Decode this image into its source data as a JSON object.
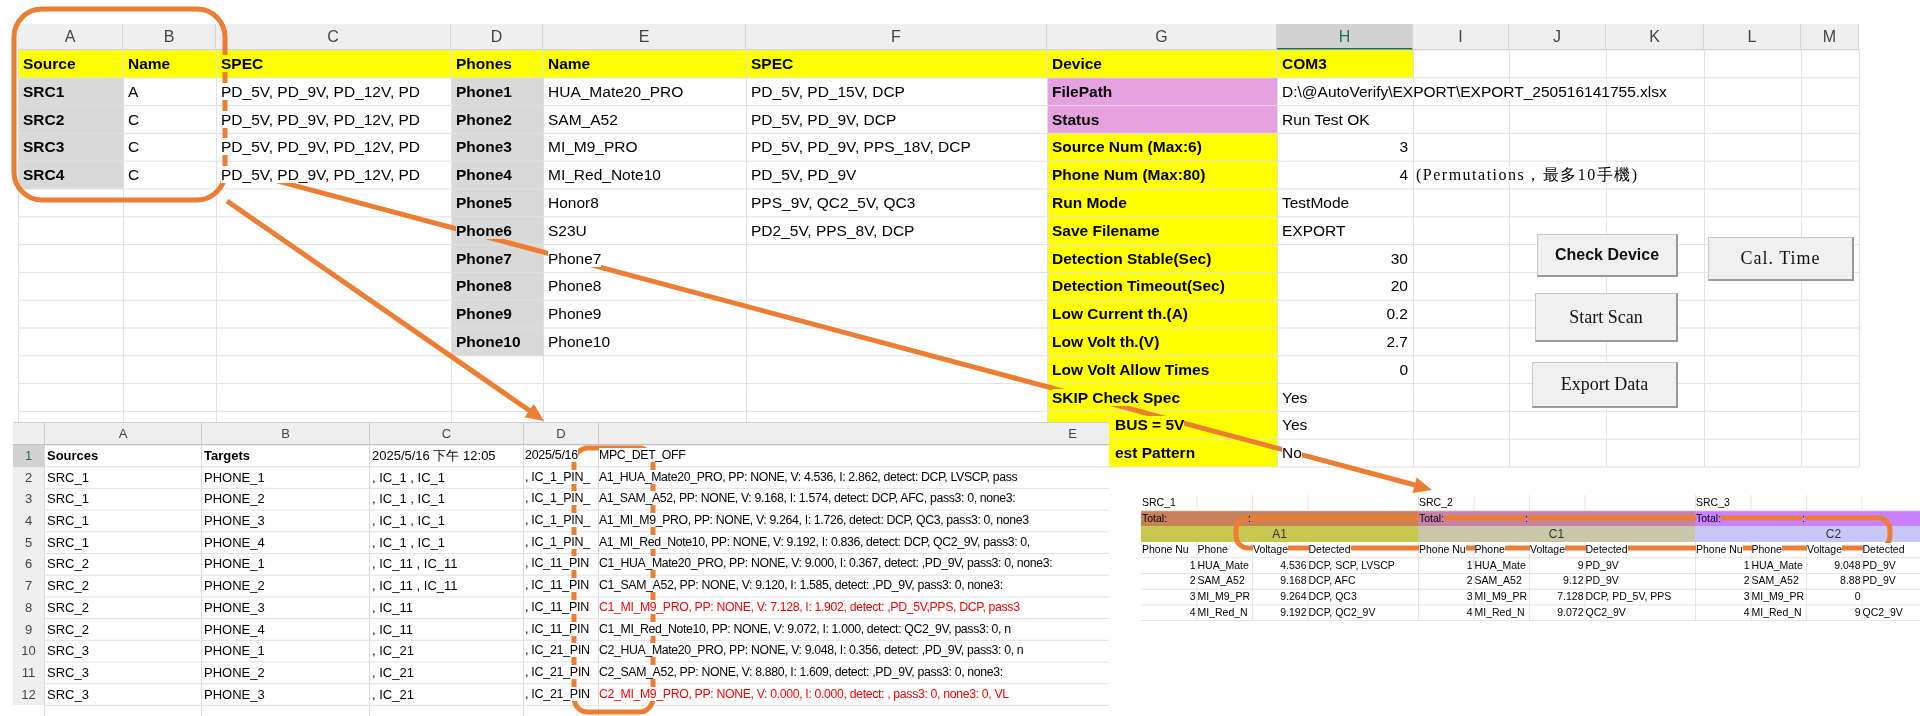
{
  "top_sheet": {
    "columns": [
      {
        "label": "A",
        "selected": false
      },
      {
        "label": "B",
        "selected": false
      },
      {
        "label": "C",
        "selected": false
      },
      {
        "label": "D",
        "selected": false
      },
      {
        "label": "E",
        "selected": false
      },
      {
        "label": "F",
        "selected": false
      },
      {
        "label": "G",
        "selected": false
      },
      {
        "label": "H",
        "selected": true
      },
      {
        "label": "I",
        "selected": false
      },
      {
        "label": "J",
        "selected": false
      },
      {
        "label": "K",
        "selected": false
      },
      {
        "label": "L",
        "selected": false
      },
      {
        "label": "M",
        "selected": false
      }
    ],
    "sources": {
      "header": [
        "Source",
        "Name",
        "SPEC"
      ],
      "rows": [
        {
          "source": "SRC1",
          "name": "A",
          "spec": "PD_5V, PD_9V, PD_12V, PD"
        },
        {
          "source": "SRC2",
          "name": "C",
          "spec": "PD_5V, PD_9V, PD_12V, PD"
        },
        {
          "source": "SRC3",
          "name": "C",
          "spec": "PD_5V, PD_9V, PD_12V, PD"
        },
        {
          "source": "SRC4",
          "name": "C",
          "spec": "PD_5V, PD_9V, PD_12V, PD"
        }
      ]
    },
    "phones": {
      "header": [
        "Phones",
        "Name",
        "SPEC"
      ],
      "rows": [
        {
          "phone": "Phone1",
          "name": "HUA_Mate20_PRO",
          "spec": "PD_5V, PD_15V, DCP"
        },
        {
          "phone": "Phone2",
          "name": "SAM_A52",
          "spec": "PD_5V, PD_9V, DCP"
        },
        {
          "phone": "Phone3",
          "name": "MI_M9_PRO",
          "spec": "PD_5V, PD_9V, PPS_18V, DCP"
        },
        {
          "phone": "Phone4",
          "name": "MI_Red_Note10",
          "spec": "PD_5V, PD_9V"
        },
        {
          "phone": "Phone5",
          "name": "Honor8",
          "spec": "PPS_9V, QC2_5V, QC3"
        },
        {
          "phone": "Phone6",
          "name": "S23U",
          "spec": "PD2_5V, PPS_8V, DCP"
        },
        {
          "phone": "Phone7",
          "name": "Phone7"
        },
        {
          "phone": "Phone8",
          "name": "Phone8"
        },
        {
          "phone": "Phone9",
          "name": "Phone9"
        },
        {
          "phone": "Phone10",
          "name": "Phone10"
        }
      ]
    },
    "settings": {
      "header": {
        "label": "Device",
        "value": "COM3",
        "color": "#ffff00"
      },
      "rows": [
        {
          "label": "FilePath",
          "value": "D:\\@AutoVerify\\EXPORT\\EXPORT_250516141755.xlsx",
          "kind": "text",
          "color": "#e6a1e0"
        },
        {
          "label": "Status",
          "value": "Run Test OK",
          "kind": "text",
          "color": "#e6a1e0"
        },
        {
          "label": "Source Num (Max:6)",
          "value": "3",
          "kind": "number",
          "color": "#ffff00"
        },
        {
          "label": "Phone Num (Max:80)",
          "value": "4",
          "kind": "number",
          "color": "#ffff00",
          "note": "(Permutations，最多10手機)"
        },
        {
          "label": "Run Mode",
          "value": "TestMode",
          "kind": "text",
          "color": "#ffff00"
        },
        {
          "label": "Save Filename",
          "value": "EXPORT",
          "kind": "text",
          "color": "#ffff00"
        },
        {
          "label": "Detection Stable(Sec)",
          "value": "30",
          "kind": "number",
          "color": "#ffff00"
        },
        {
          "label": "Detection Timeout(Sec)",
          "value": "20",
          "kind": "number",
          "color": "#ffff00"
        },
        {
          "label": "Low Current th.(A)",
          "value": "0.2",
          "kind": "number",
          "color": "#ffff00"
        },
        {
          "label": "Low Volt th.(V)",
          "value": "2.7",
          "kind": "number",
          "color": "#ffff00"
        },
        {
          "label": "Low Volt Allow Times",
          "value": "0",
          "kind": "number",
          "color": "#ffff00"
        },
        {
          "label": "SKIP Check Spec",
          "value": "Yes",
          "kind": "text",
          "color": "#ffff00"
        },
        {
          "label": "BUS = 5V",
          "value": "Yes",
          "kind": "text",
          "color": "#ffff00"
        },
        {
          "label": "est Pattern",
          "value": "No",
          "kind": "text",
          "color": "#ffff00"
        }
      ]
    },
    "buttons": [
      {
        "label": "Check Device",
        "kind": "sans"
      },
      {
        "label": "Cal. Time",
        "kind": "mono"
      },
      {
        "label": "Start Scan",
        "kind": "serif"
      },
      {
        "label": "Export Data",
        "kind": "serif"
      }
    ]
  },
  "log_sheet": {
    "columns": [
      "A",
      "B",
      "C",
      "D",
      "E"
    ],
    "rows": [
      {
        "number": "1",
        "kind": "header",
        "error": false,
        "cells": [
          "Sources",
          "Targets",
          "2025/5/16 下午 12:05",
          "2025/5/16",
          "MPC_DET_OFF"
        ]
      },
      {
        "number": "2",
        "kind": "data",
        "error": false,
        "cells": [
          "SRC_1",
          "PHONE_1",
          ", IC_1 , IC_1",
          ", IC_1_PIN_",
          "A1_HUA_Mate20_PRO, PP: NONE, V: 4.536, I: 2.862, detect: DCP, LVSCP, pass"
        ]
      },
      {
        "number": "3",
        "kind": "data",
        "error": false,
        "cells": [
          "SRC_1",
          "PHONE_2",
          ", IC_1 , IC_1",
          ", IC_1_PIN_",
          "A1_SAM_A52, PP: NONE, V: 9.168, I: 1.574, detect: DCP, AFC, pass3: 0, none3:"
        ]
      },
      {
        "number": "4",
        "kind": "data",
        "error": false,
        "cells": [
          "SRC_1",
          "PHONE_3",
          ", IC_1 , IC_1",
          ", IC_1_PIN_",
          "A1_MI_M9_PRO, PP: NONE, V: 9.264, I: 1.726, detect: DCP, QC3, pass3: 0, none3"
        ]
      },
      {
        "number": "5",
        "kind": "data",
        "error": false,
        "cells": [
          "SRC_1",
          "PHONE_4",
          ", IC_1 , IC_1",
          ", IC_1_PIN_",
          "A1_MI_Red_Note10, PP: NONE, V: 9.192, I: 0.836, detect: DCP, QC2_9V, pass3: 0,"
        ]
      },
      {
        "number": "6",
        "kind": "data",
        "error": false,
        "cells": [
          "SRC_2",
          "PHONE_1",
          ", IC_11 , IC_11",
          ", IC_11_PIN",
          "C1_HUA_Mate20_PRO, PP: NONE, V: 9.000, I: 0.367, detect: ,PD_9V, pass3: 0, none3:"
        ]
      },
      {
        "number": "7",
        "kind": "data",
        "error": false,
        "cells": [
          "SRC_2",
          "PHONE_2",
          ", IC_11 , IC_11",
          ", IC_11_PIN",
          "C1_SAM_A52, PP: NONE, V: 9.120, I: 1.585, detect: ,PD_9V, pass3: 0, none3:"
        ]
      },
      {
        "number": "8",
        "kind": "data",
        "error": true,
        "cells": [
          "SRC_2",
          "PHONE_3",
          ", IC_11",
          ", IC_11_PIN",
          "C1_MI_M9_PRO, PP: NONE, V: 7.128, I: 1.902, detect: ,PD_5V,PPS, DCP, pass3"
        ]
      },
      {
        "number": "9",
        "kind": "data",
        "error": false,
        "cells": [
          "SRC_2",
          "PHONE_4",
          ", IC_11",
          ", IC_11_PIN",
          "C1_MI_Red_Note10, PP: NONE, V: 9.072, I: 1.000, detect: QC2_9V, pass3: 0, n"
        ]
      },
      {
        "number": "10",
        "kind": "data",
        "error": false,
        "cells": [
          "SRC_3",
          "PHONE_1",
          ", IC_21",
          ", IC_21_PIN",
          "C2_HUA_Mate20_PRO, PP: NONE, V: 9.048, I: 0.356, detect: ,PD_9V, pass3: 0, n"
        ]
      },
      {
        "number": "11",
        "kind": "data",
        "error": false,
        "cells": [
          "SRC_3",
          "PHONE_2",
          ", IC_21",
          ", IC_21_PIN",
          "C2_SAM_A52, PP: NONE, V: 8.880, I: 1.609, detect: ,PD_9V, pass3: 0, none3:"
        ]
      },
      {
        "number": "12",
        "kind": "data",
        "error": true,
        "cells": [
          "SRC_3",
          "PHONE_3",
          ", IC_21",
          ", IC_21_PIN",
          "C2_MI_M9_PRO, PP: NONE, V: 0.000, I: 0.000, detect: , pass3: 0, none3: 0, VL"
        ]
      }
    ]
  },
  "summary_sheet": {
    "blocks": [
      {
        "source": "SRC_1",
        "total": {
          "label": "Total:",
          "value": ":",
          "color": "#c8825a"
        },
        "group": {
          "label": "A1",
          "color": "#c8c850"
        },
        "headers": [
          "Phone Nu",
          "Phone",
          "Voltage",
          "Detected"
        ],
        "rows": [
          {
            "num": "1",
            "phone": "HUA_Mate",
            "voltage": "4.536",
            "detected": "DCP, SCP, LVSCP"
          },
          {
            "num": "2",
            "phone": "SAM_A52",
            "voltage": "9.168",
            "detected": "DCP, AFC"
          },
          {
            "num": "3",
            "phone": "MI_M9_PR",
            "voltage": "9.264",
            "detected": "DCP, QC3"
          },
          {
            "num": "4",
            "phone": "MI_Red_N",
            "voltage": "9.192",
            "detected": "DCP, QC2_9V"
          }
        ]
      },
      {
        "source": "SRC_2",
        "total": {
          "label": "Total:",
          "value": ":",
          "color": "#c882a8"
        },
        "group": {
          "label": "C1",
          "color": "#c8c8a8"
        },
        "headers": [
          "Phone Nu",
          "Phone",
          "Voltage",
          "Detected"
        ],
        "rows": [
          {
            "num": "1",
            "phone": "HUA_Mate",
            "voltage": "9",
            "detected": "PD_9V"
          },
          {
            "num": "2",
            "phone": "SAM_A52",
            "voltage": "9.12",
            "detected": "PD_9V"
          },
          {
            "num": "3",
            "phone": "MI_M9_PR",
            "voltage": "7.128",
            "detected": "DCP, PD_5V, PPS"
          },
          {
            "num": "4",
            "phone": "MI_Red_N",
            "voltage": "9.072",
            "detected": "QC2_9V"
          }
        ]
      },
      {
        "source": "SRC_3",
        "total": {
          "label": "Total:",
          "value": ":",
          "color": "#c882ff"
        },
        "group": {
          "label": "C2",
          "color": "#c8c8f8"
        },
        "headers": [
          "Phone Nu",
          "Phone",
          "Voltage",
          "Detected"
        ],
        "rows": [
          {
            "num": "1",
            "phone": "HUA_Mate",
            "voltage": "9.048",
            "detected": "PD_9V"
          },
          {
            "num": "2",
            "phone": "SAM_A52",
            "voltage": "8.88",
            "detected": "PD_9V"
          },
          {
            "num": "3",
            "phone": "MI_M9_PR",
            "voltage": "0"
          },
          {
            "num": "4",
            "phone": "MI_Red_N",
            "voltage": "9",
            "detected": "QC2_9V"
          }
        ]
      }
    ]
  }
}
